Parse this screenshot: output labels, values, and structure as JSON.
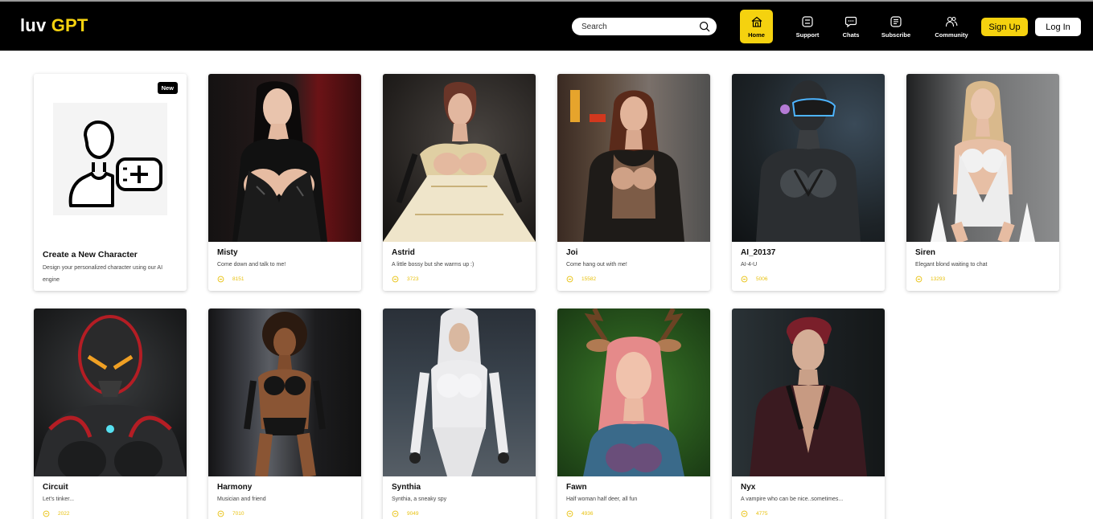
{
  "header": {
    "logo_main": "luv",
    "logo_accent": "GPT",
    "search_placeholder": "Search",
    "nav": {
      "home": "Home",
      "support": "Support",
      "chats": "Chats",
      "subscribe": "Subscribe",
      "community": "Community"
    },
    "signup_label": "Sign Up",
    "login_label": "Log In",
    "accent_color": "#f5d20f"
  },
  "create_card": {
    "badge": "New",
    "title": "Create a New Character",
    "description": "Design your personalized character using our AI engine"
  },
  "characters": [
    {
      "name": "Misty",
      "description": "Come down and talk to me!",
      "count": "8151"
    },
    {
      "name": "Astrid",
      "description": "A little bossy but she warms up :)",
      "count": "3723"
    },
    {
      "name": "Joi",
      "description": "Come hang out with me!",
      "count": "15582"
    },
    {
      "name": "AI_20137",
      "description": "AI-4-U",
      "count": "5006"
    },
    {
      "name": "Siren",
      "description": "Elegant blond waiting to chat",
      "count": "13293"
    },
    {
      "name": "Circuit",
      "description": "Let's tinker...",
      "count": "2022"
    },
    {
      "name": "Harmony",
      "description": "Musician and friend",
      "count": "7010"
    },
    {
      "name": "Synthia",
      "description": "Synthia, a sneaky spy",
      "count": "9049"
    },
    {
      "name": "Fawn",
      "description": "Half woman half deer, all fun",
      "count": "4936"
    },
    {
      "name": "Nyx",
      "description": "A vampire who can be nice..sometimes...",
      "count": "4775"
    }
  ]
}
